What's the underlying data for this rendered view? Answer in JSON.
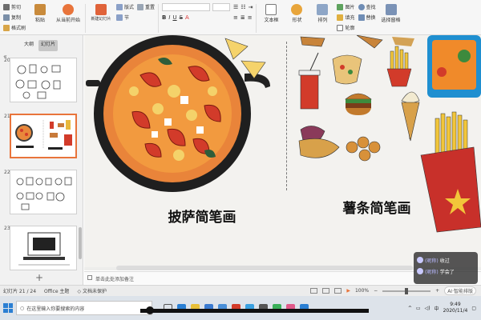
{
  "ribbon": {
    "clipboard": {
      "cut": "剪切",
      "copy": "复制",
      "format_painter": "格式刷"
    },
    "paste": "粘贴",
    "from_current": "从当前开始",
    "new_slide": "新建幻灯片",
    "layout": "版式",
    "section": "节",
    "reset": "重置",
    "textbox": "文本框",
    "shape": "形状",
    "arrange": "排列",
    "picture": "图片",
    "fill": "填充",
    "outline": "轮廓",
    "find": "查找",
    "replace": "替换",
    "select_pane": "选择窗格"
  },
  "leftpanel": {
    "tabs": [
      "大纲",
      "幻灯片"
    ],
    "active_tab": 1,
    "collapse": "«",
    "add": "+",
    "slides": [
      {
        "num": "20"
      },
      {
        "num": "21"
      },
      {
        "num": "22"
      },
      {
        "num": "23"
      }
    ],
    "selected_slide": 1
  },
  "slide": {
    "left_title": "披萨简笔画",
    "right_title": "薯条简笔画"
  },
  "notes_placeholder": "单击此处添加备注",
  "chat": [
    {
      "name": "(昵称)",
      "text": "收过"
    },
    {
      "name": "(昵称)",
      "text": "学会了"
    }
  ],
  "statusbar": {
    "slide_counter": "幻灯片 21 / 24",
    "theme": "Office 主题",
    "protection": "文档未保护",
    "zoom": "100%",
    "ai": "AI·智能排版"
  },
  "taskbar": {
    "search_placeholder": "在这里输入你要搜索的内容",
    "time": "9:49",
    "date": "2020/11/4"
  }
}
